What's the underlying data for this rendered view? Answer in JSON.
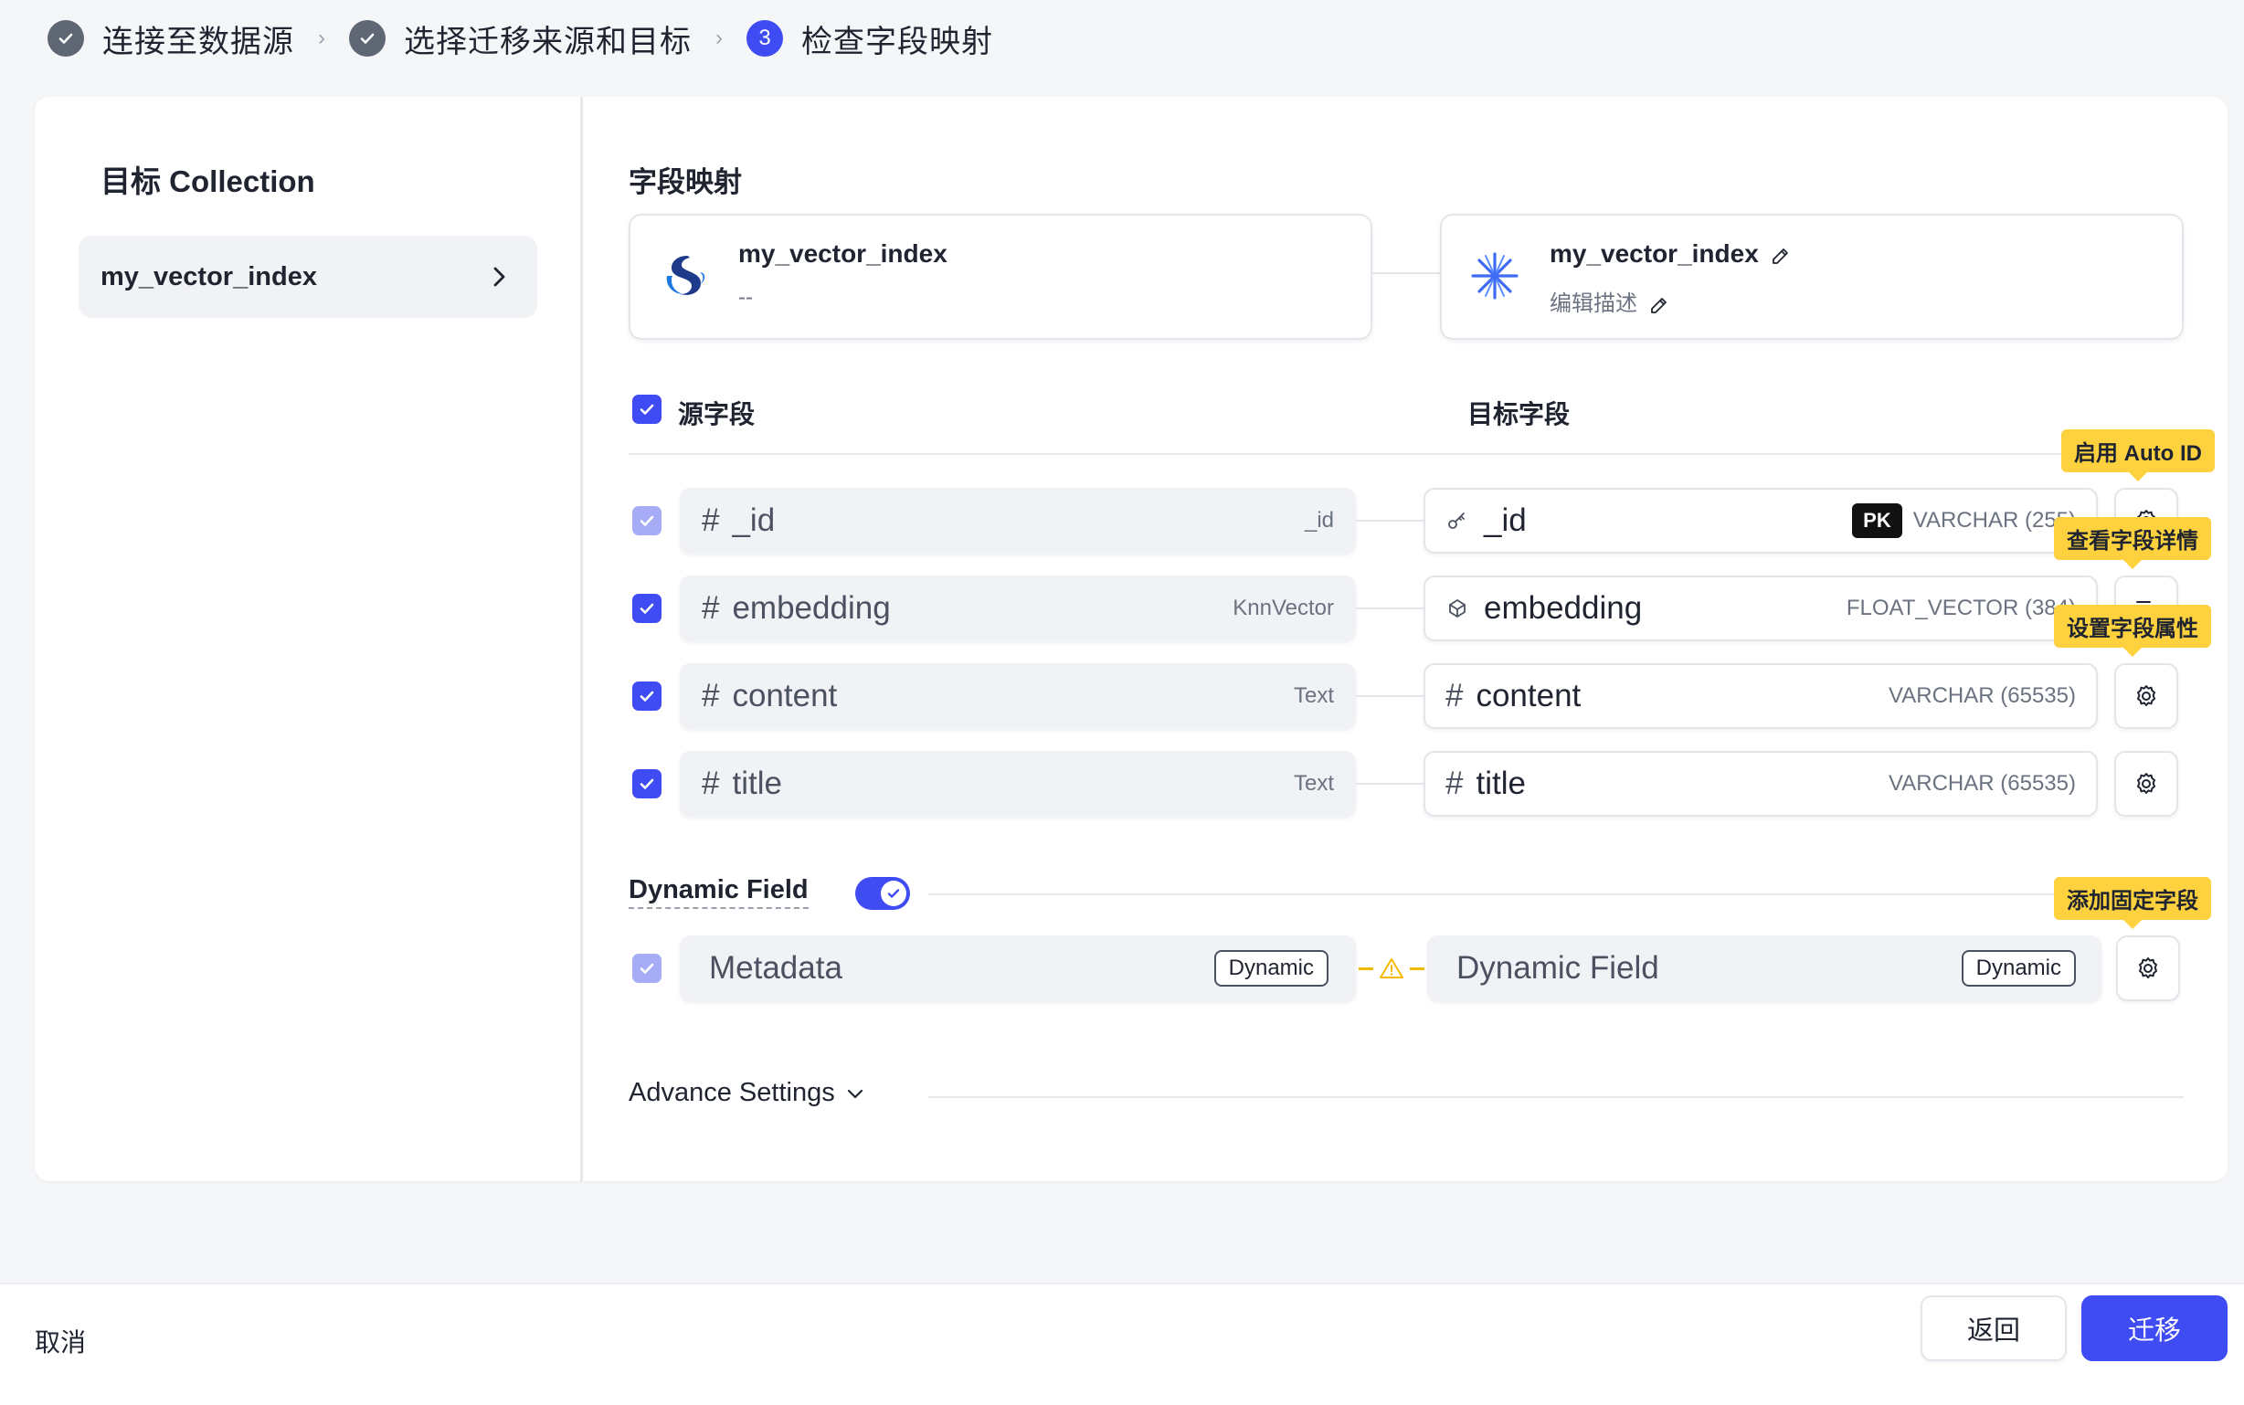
{
  "stepper": {
    "steps": [
      {
        "label": "连接至数据源",
        "state": "done"
      },
      {
        "label": "选择迁移来源和目标",
        "state": "done"
      },
      {
        "label": "检查字段映射",
        "state": "active",
        "number": "3"
      }
    ]
  },
  "sidebar": {
    "title": "目标 Collection",
    "collections": [
      {
        "name": "my_vector_index"
      }
    ]
  },
  "mapping": {
    "title": "字段映射",
    "source_collection": {
      "name": "my_vector_index",
      "description": "--"
    },
    "target_collection": {
      "name": "my_vector_index",
      "description": "编辑描述"
    },
    "source_header": "源字段",
    "target_header": "目标字段",
    "rows": [
      {
        "source": "_id",
        "source_type": "_id",
        "target": "_id",
        "target_type": "VARCHAR (255)",
        "pk": "PK",
        "tooltip": "启用 Auto ID",
        "action_icon": "gear-icon"
      },
      {
        "source": "embedding",
        "source_type": "KnnVector",
        "target": "embedding",
        "target_type": "FLOAT_VECTOR (384)",
        "tooltip": "查看字段详情",
        "action_icon": "list-search-icon"
      },
      {
        "source": "content",
        "source_type": "Text",
        "target": "content",
        "target_type": "VARCHAR (65535)",
        "tooltip": "设置字段属性",
        "action_icon": "gear-icon"
      },
      {
        "source": "title",
        "source_type": "Text",
        "target": "title",
        "target_type": "VARCHAR (65535)",
        "action_icon": "gear-icon"
      }
    ],
    "hash_symbol": "#"
  },
  "dynamic": {
    "title": "Dynamic Field",
    "enabled": true,
    "source": "Metadata",
    "source_badge": "Dynamic",
    "target": "Dynamic Field",
    "target_badge": "Dynamic",
    "tooltip": "添加固定字段"
  },
  "advance": {
    "label": "Advance Settings"
  },
  "footer": {
    "cancel": "取消",
    "back": "返回",
    "migrate": "迁移"
  },
  "colors": {
    "primary": "#3f4bf3",
    "tooltip": "#fdd23e",
    "warning": "#f5b800"
  }
}
